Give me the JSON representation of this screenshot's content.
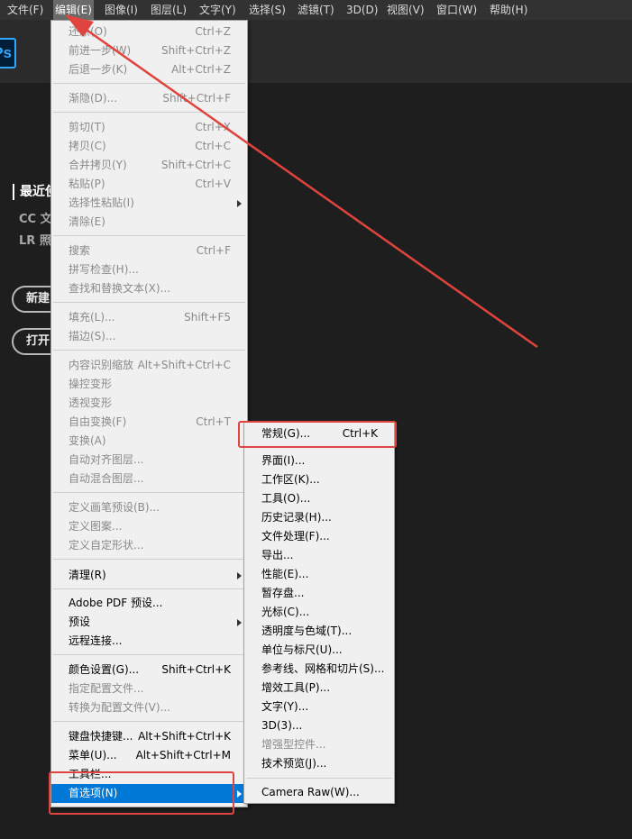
{
  "menubar": {
    "items": [
      {
        "label": "文件(F)"
      },
      {
        "label": "编辑(E)"
      },
      {
        "label": "图像(I)"
      },
      {
        "label": "图层(L)"
      },
      {
        "label": "文字(Y)"
      },
      {
        "label": "选择(S)"
      },
      {
        "label": "滤镜(T)"
      },
      {
        "label": "3D(D)"
      },
      {
        "label": "视图(V)"
      },
      {
        "label": "窗口(W)"
      },
      {
        "label": "帮助(H)"
      }
    ]
  },
  "app": {
    "logo_text": "Ps"
  },
  "home": {
    "recent_label": "最近使",
    "nav": [
      {
        "label": "CC 文"
      },
      {
        "label": "LR 照"
      }
    ],
    "new_button": "新建",
    "open_button": "打开"
  },
  "edit_menu": {
    "items": [
      {
        "label": "还原(O)",
        "shortcut": "Ctrl+Z"
      },
      {
        "label": "前进一步(W)",
        "shortcut": "Shift+Ctrl+Z"
      },
      {
        "label": "后退一步(K)",
        "shortcut": "Alt+Ctrl+Z"
      },
      {
        "label": "渐隐(D)...",
        "shortcut": "Shift+Ctrl+F"
      },
      {
        "label": "剪切(T)",
        "shortcut": "Ctrl+X"
      },
      {
        "label": "拷贝(C)",
        "shortcut": "Ctrl+C"
      },
      {
        "label": "合并拷贝(Y)",
        "shortcut": "Shift+Ctrl+C"
      },
      {
        "label": "粘贴(P)",
        "shortcut": "Ctrl+V"
      },
      {
        "label": "选择性粘贴(I)",
        "shortcut": ""
      },
      {
        "label": "清除(E)",
        "shortcut": ""
      },
      {
        "label": "搜索",
        "shortcut": "Ctrl+F"
      },
      {
        "label": "拼写检查(H)...",
        "shortcut": ""
      },
      {
        "label": "查找和替换文本(X)...",
        "shortcut": ""
      },
      {
        "label": "填充(L)...",
        "shortcut": "Shift+F5"
      },
      {
        "label": "描边(S)...",
        "shortcut": ""
      },
      {
        "label": "内容识别缩放",
        "shortcut": "Alt+Shift+Ctrl+C"
      },
      {
        "label": "操控变形",
        "shortcut": ""
      },
      {
        "label": "透视变形",
        "shortcut": ""
      },
      {
        "label": "自由变换(F)",
        "shortcut": "Ctrl+T"
      },
      {
        "label": "变换(A)",
        "shortcut": ""
      },
      {
        "label": "自动对齐图层...",
        "shortcut": ""
      },
      {
        "label": "自动混合图层...",
        "shortcut": ""
      },
      {
        "label": "定义画笔预设(B)...",
        "shortcut": ""
      },
      {
        "label": "定义图案...",
        "shortcut": ""
      },
      {
        "label": "定义自定形状...",
        "shortcut": ""
      },
      {
        "label": "清理(R)",
        "shortcut": ""
      },
      {
        "label": "Adobe PDF 预设...",
        "shortcut": ""
      },
      {
        "label": "预设",
        "shortcut": ""
      },
      {
        "label": "远程连接...",
        "shortcut": ""
      },
      {
        "label": "颜色设置(G)...",
        "shortcut": "Shift+Ctrl+K"
      },
      {
        "label": "指定配置文件...",
        "shortcut": ""
      },
      {
        "label": "转换为配置文件(V)...",
        "shortcut": ""
      },
      {
        "label": "键盘快捷键...",
        "shortcut": "Alt+Shift+Ctrl+K"
      },
      {
        "label": "菜单(U)...",
        "shortcut": "Alt+Shift+Ctrl+M"
      },
      {
        "label": "工具栏...",
        "shortcut": ""
      },
      {
        "label": "首选项(N)",
        "shortcut": ""
      }
    ]
  },
  "prefs_menu": {
    "items": [
      {
        "label": "常规(G)...",
        "shortcut": "Ctrl+K"
      },
      {
        "label": "界面(I)..."
      },
      {
        "label": "工作区(K)..."
      },
      {
        "label": "工具(O)..."
      },
      {
        "label": "历史记录(H)..."
      },
      {
        "label": "文件处理(F)..."
      },
      {
        "label": "导出..."
      },
      {
        "label": "性能(E)..."
      },
      {
        "label": "暂存盘..."
      },
      {
        "label": "光标(C)..."
      },
      {
        "label": "透明度与色域(T)..."
      },
      {
        "label": "单位与标尺(U)..."
      },
      {
        "label": "参考线、网格和切片(S)..."
      },
      {
        "label": "增效工具(P)..."
      },
      {
        "label": "文字(Y)..."
      },
      {
        "label": "3D(3)..."
      },
      {
        "label": "增强型控件..."
      },
      {
        "label": "技术预览(J)..."
      },
      {
        "label": "Camera Raw(W)..."
      }
    ]
  },
  "colors": {
    "highlight": "#0078d7",
    "annotation": "#e0443e",
    "ps_blue": "#31a8ff"
  }
}
